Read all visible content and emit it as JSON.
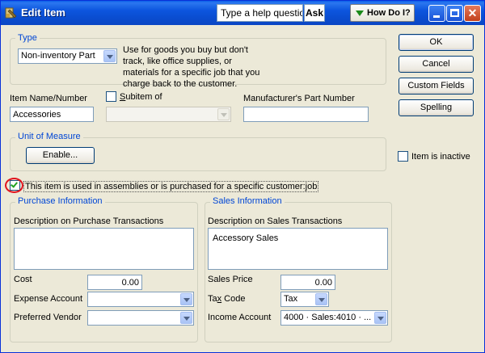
{
  "window": {
    "title": "Edit Item"
  },
  "helpbar": {
    "question_placeholder": "Type a help question",
    "ask_label": "Ask",
    "howdoi_label": "How Do I?"
  },
  "buttons": {
    "ok": "OK",
    "cancel": "Cancel",
    "custom_fields": "Custom Fields",
    "spelling": "Spelling"
  },
  "type_group": {
    "label": "Type",
    "selected": "Non-inventory Part",
    "description": "Use for goods you buy but don't track, like office supplies, or materials for a specific job that you charge back to the customer."
  },
  "item_name": {
    "label": "Item Name/Number",
    "value": "Accessories"
  },
  "subitem": {
    "label_prefix": "",
    "label_underlined": "S",
    "label_rest": "ubitem of",
    "checked": false,
    "value": ""
  },
  "manufacturer": {
    "label": "Manufacturer's Part Number",
    "value": ""
  },
  "unit_of_measure": {
    "label": "Unit of Measure",
    "enable_label": "Enable..."
  },
  "inactive": {
    "label": "Item is inactive",
    "checked": false
  },
  "assemblies": {
    "label": "This item is used in assemblies or is purchased for a specific customer:job",
    "checked": true
  },
  "purchase": {
    "group_label": "Purchase Information",
    "desc_label": "Description on Purchase Transactions",
    "desc_value": "",
    "cost_label": "Cost",
    "cost_value": "0.00",
    "expense_label": "Expense Account",
    "expense_value": "",
    "vendor_label": "Preferred Vendor",
    "vendor_value": ""
  },
  "sales": {
    "group_label": "Sales Information",
    "desc_label": "Description on Sales Transactions",
    "desc_value": "Accessory Sales",
    "price_label": "Sales Price",
    "price_value": "0.00",
    "taxcode_label_prefix": "Ta",
    "taxcode_label_underlined": "x",
    "taxcode_label_rest": " Code",
    "taxcode_value": "Tax",
    "income_label": "Income Account",
    "income_value": "4000 · Sales:4010 · ..."
  }
}
